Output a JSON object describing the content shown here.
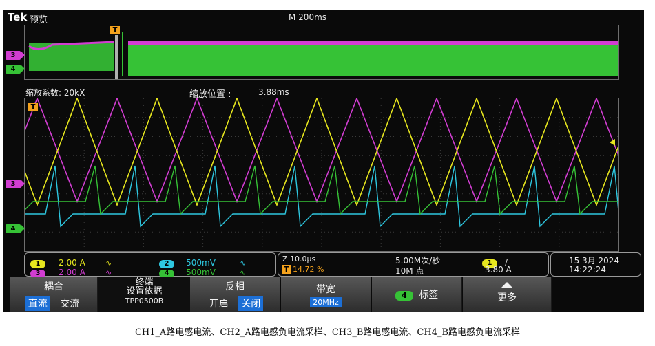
{
  "header": {
    "brand": "Tek",
    "mode": "预览",
    "timebase": "M 200ms"
  },
  "zoom": {
    "factor_label": "缩放系数: 20kX",
    "position_label": "缩放位置 :",
    "position_value": "3.88ms"
  },
  "markers": {
    "trigger": "T",
    "ch3": "3",
    "ch4": "4"
  },
  "channels": [
    {
      "id": "1",
      "scale": "2.00 A",
      "coupling_icon": "bandwidth-icon",
      "color": "#e6e61e"
    },
    {
      "id": "2",
      "scale": "500mV",
      "coupling_icon": "bandwidth-icon",
      "color": "#2ec7e0"
    },
    {
      "id": "3",
      "scale": "2.00 A",
      "coupling_icon": "bandwidth-icon",
      "color": "#d23dd2"
    },
    {
      "id": "4",
      "scale": "500mV",
      "coupling_icon": "bandwidth-icon",
      "color": "#36c236"
    }
  ],
  "horizontal": {
    "scale": "10.0µs",
    "trigger_pos": "14.72 %",
    "sample_rate": "5.00M次/秒",
    "record_length": "10M 点"
  },
  "trigger": {
    "channel": "1",
    "slope": "/",
    "level": "3.80 A"
  },
  "datetime": {
    "date": "15 3月 2024",
    "time": "14:22:24"
  },
  "menu": {
    "coupling_title": "耦合",
    "coupling_options": [
      "直流",
      "交流"
    ],
    "termination_title": "终端",
    "termination_sub": "设置依据",
    "termination_probe": "TPP0500B",
    "invert_title": "反相",
    "invert_options": [
      "开启",
      "关闭"
    ],
    "bandwidth_title": "带宽",
    "bandwidth_value": "20MHz",
    "label_channel": "4",
    "label_text": "标签",
    "more": "更多"
  },
  "caption": "CH1_A路电感电流、CH2_A路电感负电流采样、CH3_B路电感电流、CH4_B路电感负电流采样",
  "colors": {
    "ch1": "#e6e61e",
    "ch2": "#2ec7e0",
    "ch3": "#d23dd2",
    "ch4": "#36c236",
    "trigger": "#f4a21c",
    "selected": "#1c6fd6"
  }
}
